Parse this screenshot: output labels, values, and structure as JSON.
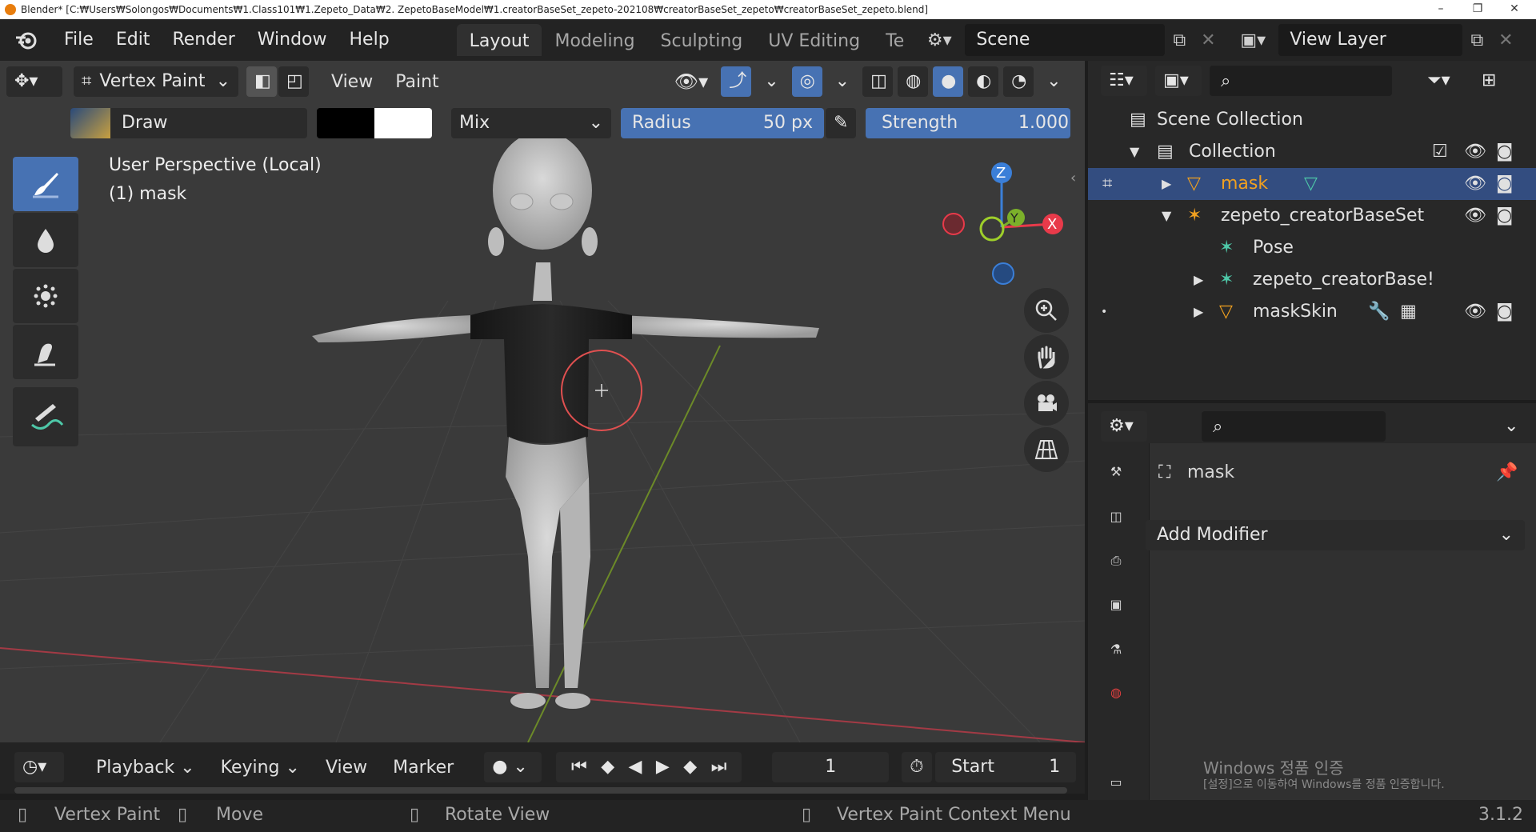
{
  "window": {
    "title": "Blender* [C:₩Users₩Solongos₩Documents₩1.Class101₩1.Zepeto_Data₩2. ZepetoBaseModel₩1.creatorBaseSet_zepeto-202108₩creatorBaseSet_zepeto₩creatorBaseSet_zepeto.blend]",
    "minimize": "–",
    "restore": "❐",
    "close": "✕"
  },
  "menus": [
    "File",
    "Edit",
    "Render",
    "Window",
    "Help"
  ],
  "workspaces": [
    "Layout",
    "Modeling",
    "Sculpting",
    "UV Editing",
    "Te"
  ],
  "scene": {
    "label": "Scene"
  },
  "view_layer": {
    "label": "View Layer"
  },
  "viewport_header": {
    "mode": "Vertex Paint",
    "view": "View",
    "paint": "Paint"
  },
  "tool_settings": {
    "brush": "Draw",
    "blend": "Mix",
    "radius_label": "Radius",
    "radius_value": "50 px",
    "strength_label": "Strength",
    "strength_value": "1.000"
  },
  "viewport": {
    "perspective": "User Perspective (Local)",
    "object": "(1) mask",
    "axis_x": "X",
    "axis_y": "Y",
    "axis_z": "Z"
  },
  "timeline": {
    "playback": "Playback",
    "keying": "Keying",
    "view": "View",
    "marker": "Marker",
    "frame": "1",
    "start_label": "Start",
    "start_value": "1"
  },
  "outliner": {
    "scene_collection": "Scene Collection",
    "collection": "Collection",
    "items": [
      "mask",
      "zepeto_creatorBaseSet",
      "Pose",
      "zepeto_creatorBase!",
      "maskSkin"
    ]
  },
  "properties": {
    "object_name": "mask",
    "add_modifier": "Add Modifier"
  },
  "watermark": {
    "line1": "Windows 정품 인증",
    "line2": "[설정]으로 이동하여 Windows를 정품 인증합니다."
  },
  "status": {
    "left": "Vertex Paint",
    "middle": "Move",
    "rotate": "Rotate View",
    "context": "Vertex Paint Context Menu",
    "version": "3.1.2"
  },
  "colors": {
    "accent": "#4772b3",
    "selected": "#334d80",
    "mask_text": "#f0a020",
    "x_axis": "#e83a4a",
    "y_axis": "#7bb02a",
    "z_axis": "#3b7fd8"
  }
}
